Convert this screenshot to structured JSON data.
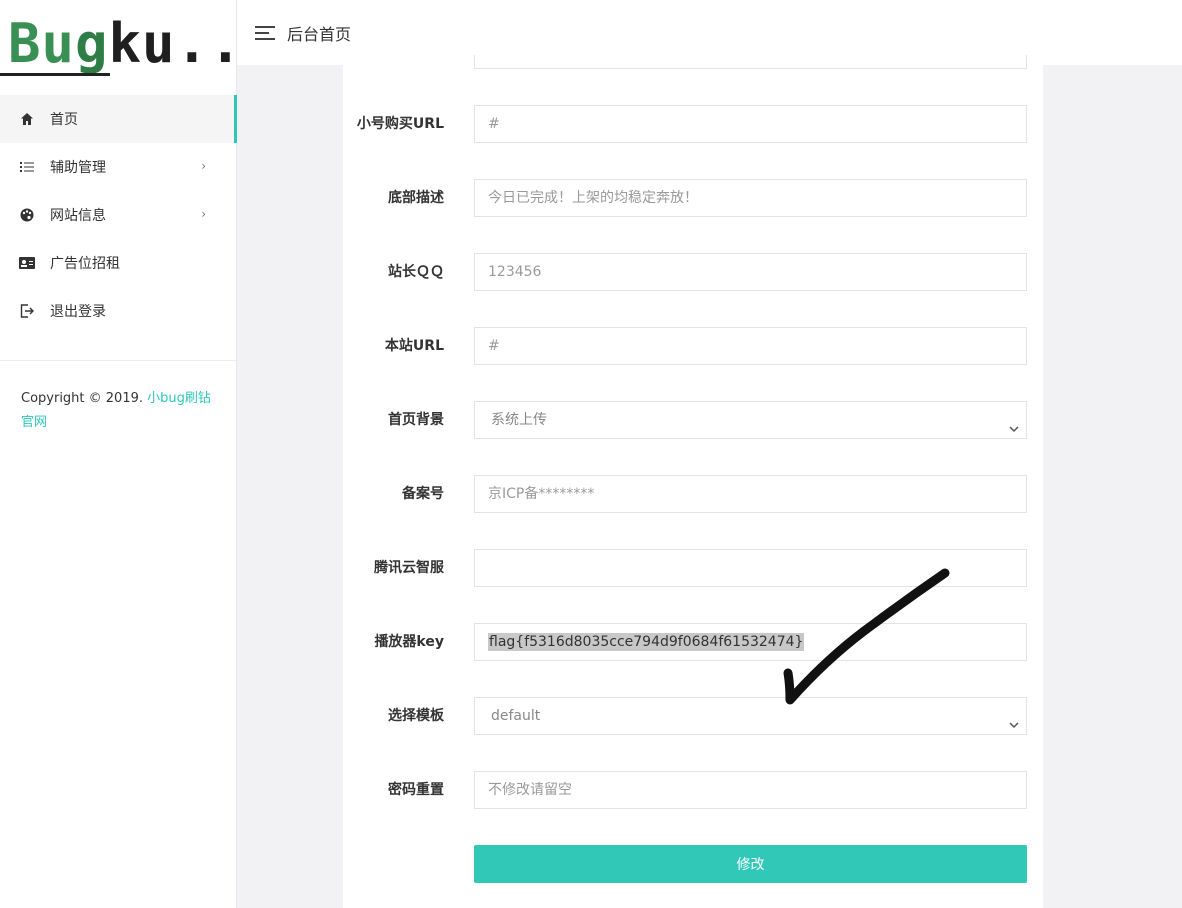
{
  "logo": {
    "text_b": "B",
    "text_u": "u",
    "text_g": "g",
    "text_rest": "ku..."
  },
  "sidebar": {
    "items": [
      {
        "label": "首页",
        "icon": "home-icon",
        "active": true
      },
      {
        "label": "辅助管理",
        "icon": "list-icon",
        "has_submenu": true
      },
      {
        "label": "网站信息",
        "icon": "palette-icon",
        "has_submenu": true
      },
      {
        "label": "广告位招租",
        "icon": "id-card-icon"
      },
      {
        "label": "退出登录",
        "icon": "logout-icon"
      }
    ],
    "copyright_prefix": "Copyright © 2019. ",
    "copyright_link": "小bug刷钻官网"
  },
  "header": {
    "title": "后台首页"
  },
  "form": {
    "fields": [
      {
        "label": "小号购买URL",
        "value": "",
        "placeholder": "#",
        "type": "text"
      },
      {
        "label": "底部描述",
        "value": "",
        "placeholder": "今日已完成！上架的均稳定奔放！",
        "type": "text"
      },
      {
        "label": "站长ＱＱ",
        "value": "",
        "placeholder": "123456",
        "type": "text"
      },
      {
        "label": "本站URL",
        "value": "",
        "placeholder": "#",
        "type": "text"
      },
      {
        "label": "首页背景",
        "value": "系统上传",
        "type": "select"
      },
      {
        "label": "备案号",
        "value": "",
        "placeholder": "京ICP备********",
        "type": "text"
      },
      {
        "label": "腾讯云智服",
        "value": "",
        "placeholder": "",
        "type": "text"
      },
      {
        "label": "播放器key",
        "value": "flag{f5316d8035cce794d9f0684f61532474}",
        "type": "text",
        "selected": true
      },
      {
        "label": "选择模板",
        "value": "default",
        "type": "select"
      },
      {
        "label": "密码重置",
        "value": "",
        "placeholder": "不修改请留空",
        "type": "text"
      }
    ],
    "submit_label": "修改"
  },
  "colors": {
    "accent": "#32c8b8",
    "active_bar": "#2ec7b6",
    "selection": "#c8c8c8"
  }
}
